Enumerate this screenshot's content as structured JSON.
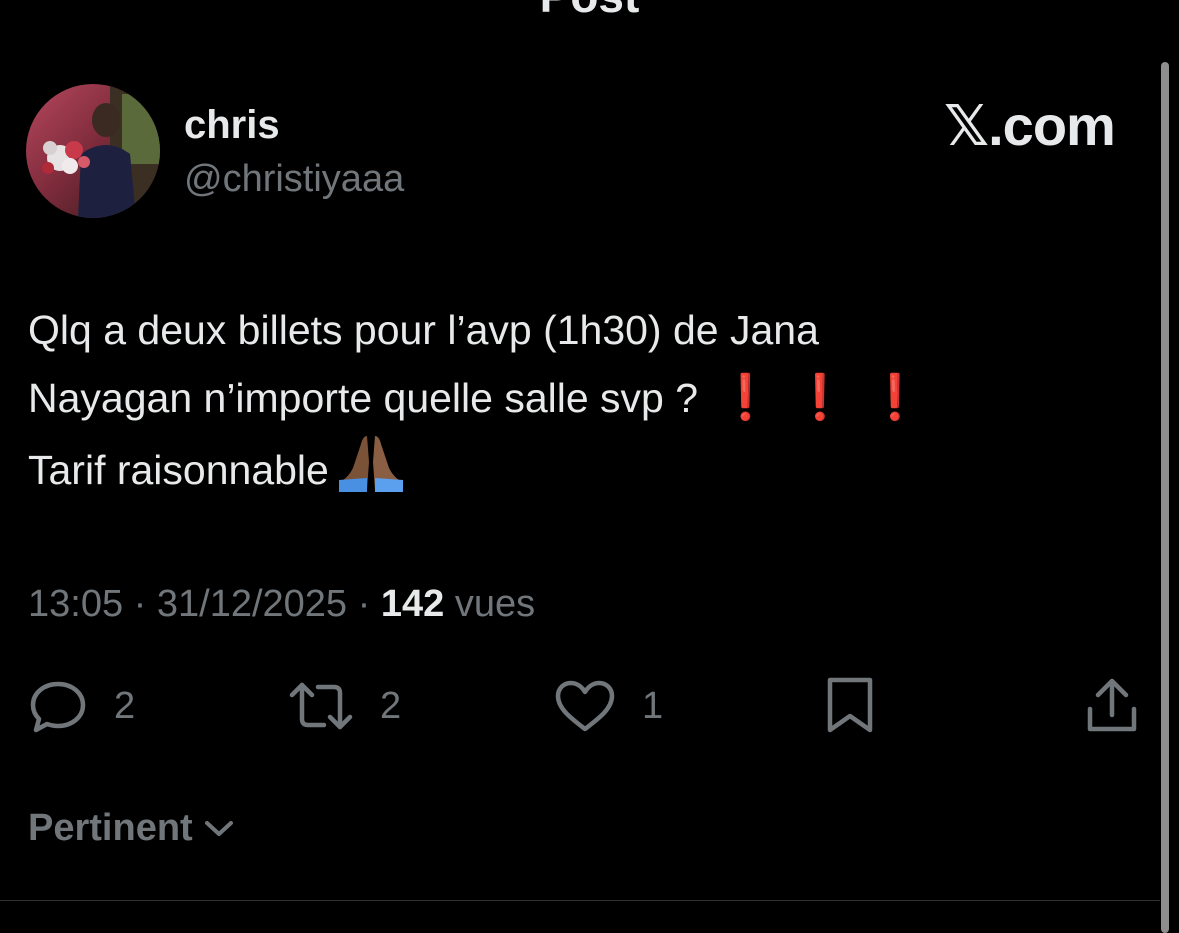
{
  "header": {
    "title": "Post",
    "back_icon": "arrow-left-icon",
    "more_icon": "more-horizontal-icon"
  },
  "author": {
    "display_name": "chris",
    "handle": "@christiyaaa"
  },
  "brand": "𝕏.com",
  "post": {
    "line1": "Qlq a deux billets pour l’avp (1h30) de Jana",
    "line2": "Nayagan n’importe quelle salle svp ?",
    "exclamation": "❗",
    "line3": "Tarif raisonnable",
    "emoji_icon": "folded-hands-icon"
  },
  "meta": {
    "time": "13:05",
    "separator": "·",
    "date": "31/12/2025",
    "views_count": "142",
    "views_label": "vues"
  },
  "actions": {
    "replies": "2",
    "reposts": "2",
    "likes": "1"
  },
  "sort": {
    "label": "Pertinent"
  },
  "colors": {
    "background": "#000000",
    "text": "#e7e9ea",
    "muted": "#71767b",
    "alert": "#f4212e"
  }
}
